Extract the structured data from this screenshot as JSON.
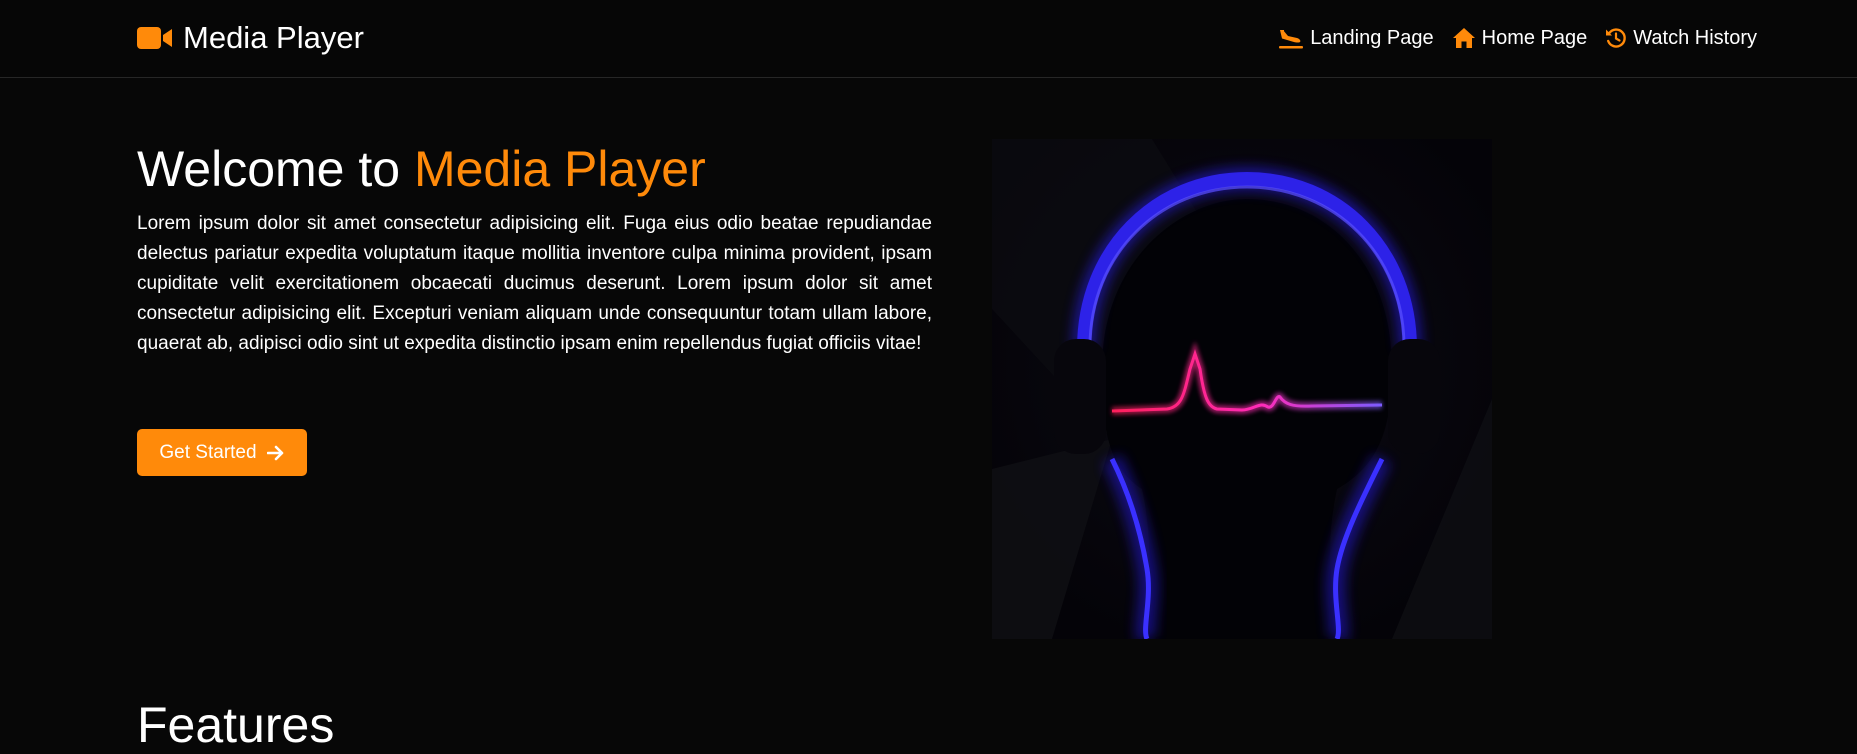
{
  "colors": {
    "accent": "#ff8a0a",
    "background": "#070707",
    "text": "#ffffff"
  },
  "navbar": {
    "brand_icon": "video-camera-icon",
    "brand_name": "Media Player",
    "links": [
      {
        "label": "Landing Page",
        "icon": "plane-landing-icon"
      },
      {
        "label": "Home Page",
        "icon": "home-icon"
      },
      {
        "label": "Watch History",
        "icon": "history-icon"
      }
    ]
  },
  "hero": {
    "title_prefix": "Welcome to",
    "title_accent": "Media Player",
    "paragraph": "Lorem ipsum dolor sit amet consectetur adipisicing elit. Fuga eius odio beatae repudiandae delectus pariatur expedita voluptatum itaque mollitia inventore culpa minima provident, ipsam cupiditate velit exercitationem obcaecati ducimus deserunt. Lorem ipsum dolor sit amet consectetur adipisicing elit. Excepturi veniam aliquam unde consequuntur totam ullam labore, quaerat ab, adipisci odio sint ut expedita distinctio ipsam enim repellendus fugiat officiis vitae!",
    "cta_label": "Get Started",
    "cta_icon": "arrow-right-icon",
    "image_subject": "headphones-heartbeat-illustration"
  },
  "features": {
    "title": "Features"
  }
}
